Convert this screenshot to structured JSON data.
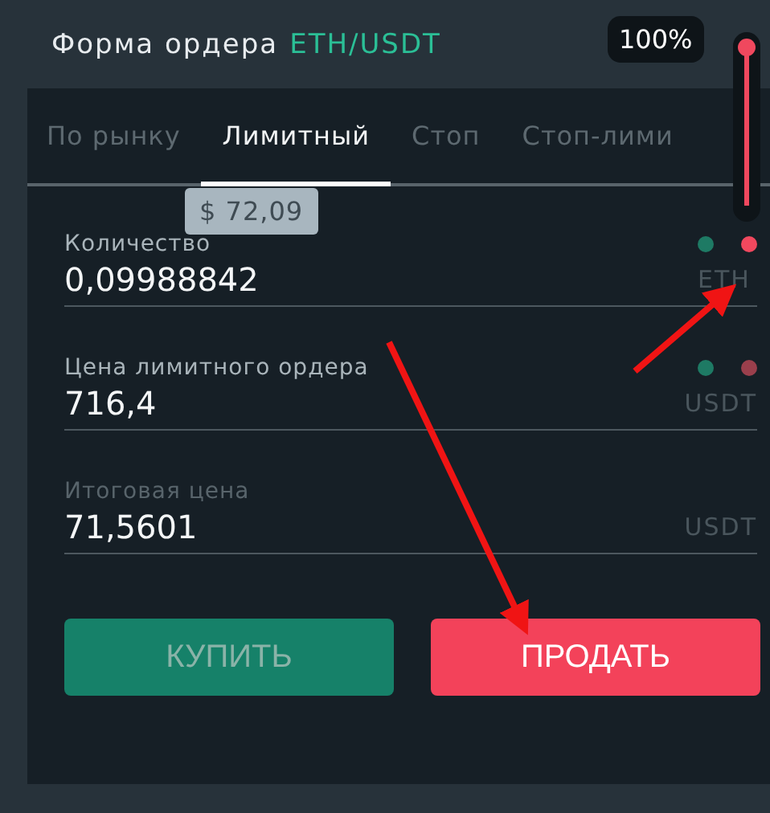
{
  "header": {
    "title": "Форма ордера",
    "pair": "ETH/USDT",
    "percent": "100%"
  },
  "slider": {
    "level": 1
  },
  "tabs": [
    {
      "label": "По рынку",
      "selected": false
    },
    {
      "label": "Лимитный",
      "selected": true
    },
    {
      "label": "Стоп",
      "selected": false
    },
    {
      "label": "Стоп-лими",
      "selected": false
    }
  ],
  "tooltip": "$ 72,09",
  "fields": [
    {
      "label": "Количество",
      "value": "0,09988842",
      "unit": "ETH",
      "dim": false,
      "dots": [
        {
          "color": "#1e7a64"
        },
        {
          "color": "#f0485e"
        }
      ]
    },
    {
      "label": "Цена лимитного ордера",
      "value": "716,4",
      "unit": "USDT",
      "dim": false,
      "dots": [
        {
          "color": "#1e7a64"
        },
        {
          "color": "#9a3f4c"
        }
      ]
    },
    {
      "label": "Итоговая цена",
      "value": "71,5601",
      "unit": "USDT",
      "dim": true
    }
  ],
  "buttons": [
    {
      "label": "КУПИТЬ",
      "kind": "buy",
      "active": false
    },
    {
      "label": "ПРОДАТЬ",
      "kind": "sell",
      "active": true
    }
  ]
}
